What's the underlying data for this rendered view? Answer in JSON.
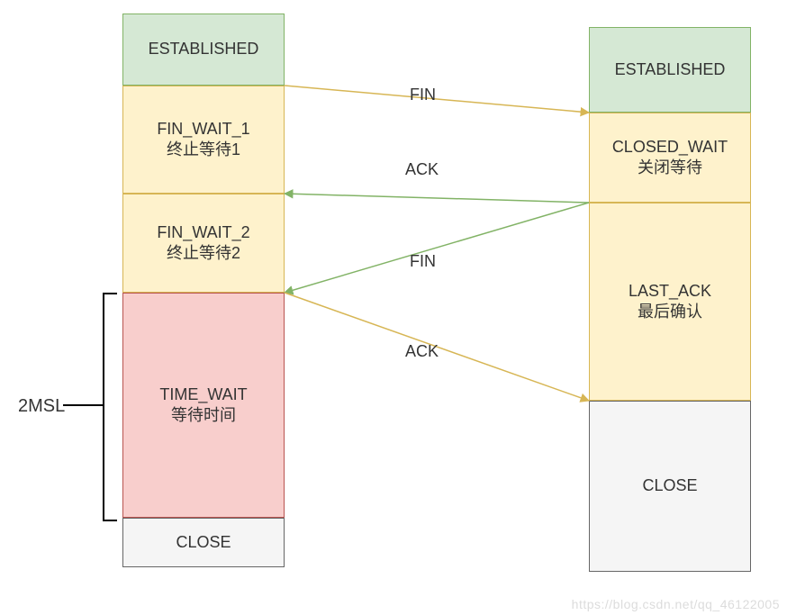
{
  "left": {
    "established": "ESTABLISHED",
    "fin_wait_1": {
      "en": "FIN_WAIT_1",
      "zh": "终止等待1"
    },
    "fin_wait_2": {
      "en": "FIN_WAIT_2",
      "zh": "终止等待2"
    },
    "time_wait": {
      "en": "TIME_WAIT",
      "zh": "等待时间"
    },
    "close": "CLOSE"
  },
  "right": {
    "established": "ESTABLISHED",
    "closed_wait": {
      "en": "CLOSED_WAIT",
      "zh": "关闭等待"
    },
    "last_ack": {
      "en": "LAST_ACK",
      "zh": "最后确认"
    },
    "close": "CLOSE"
  },
  "messages": {
    "fin1": "FIN",
    "ack1": "ACK",
    "fin2": "FIN",
    "ack2": "ACK"
  },
  "side": {
    "msl": "2MSL"
  },
  "watermark": "https://blog.csdn.net/qq_46122005",
  "colors": {
    "arrow_out": "#d7b655",
    "arrow_in": "#82b366"
  }
}
